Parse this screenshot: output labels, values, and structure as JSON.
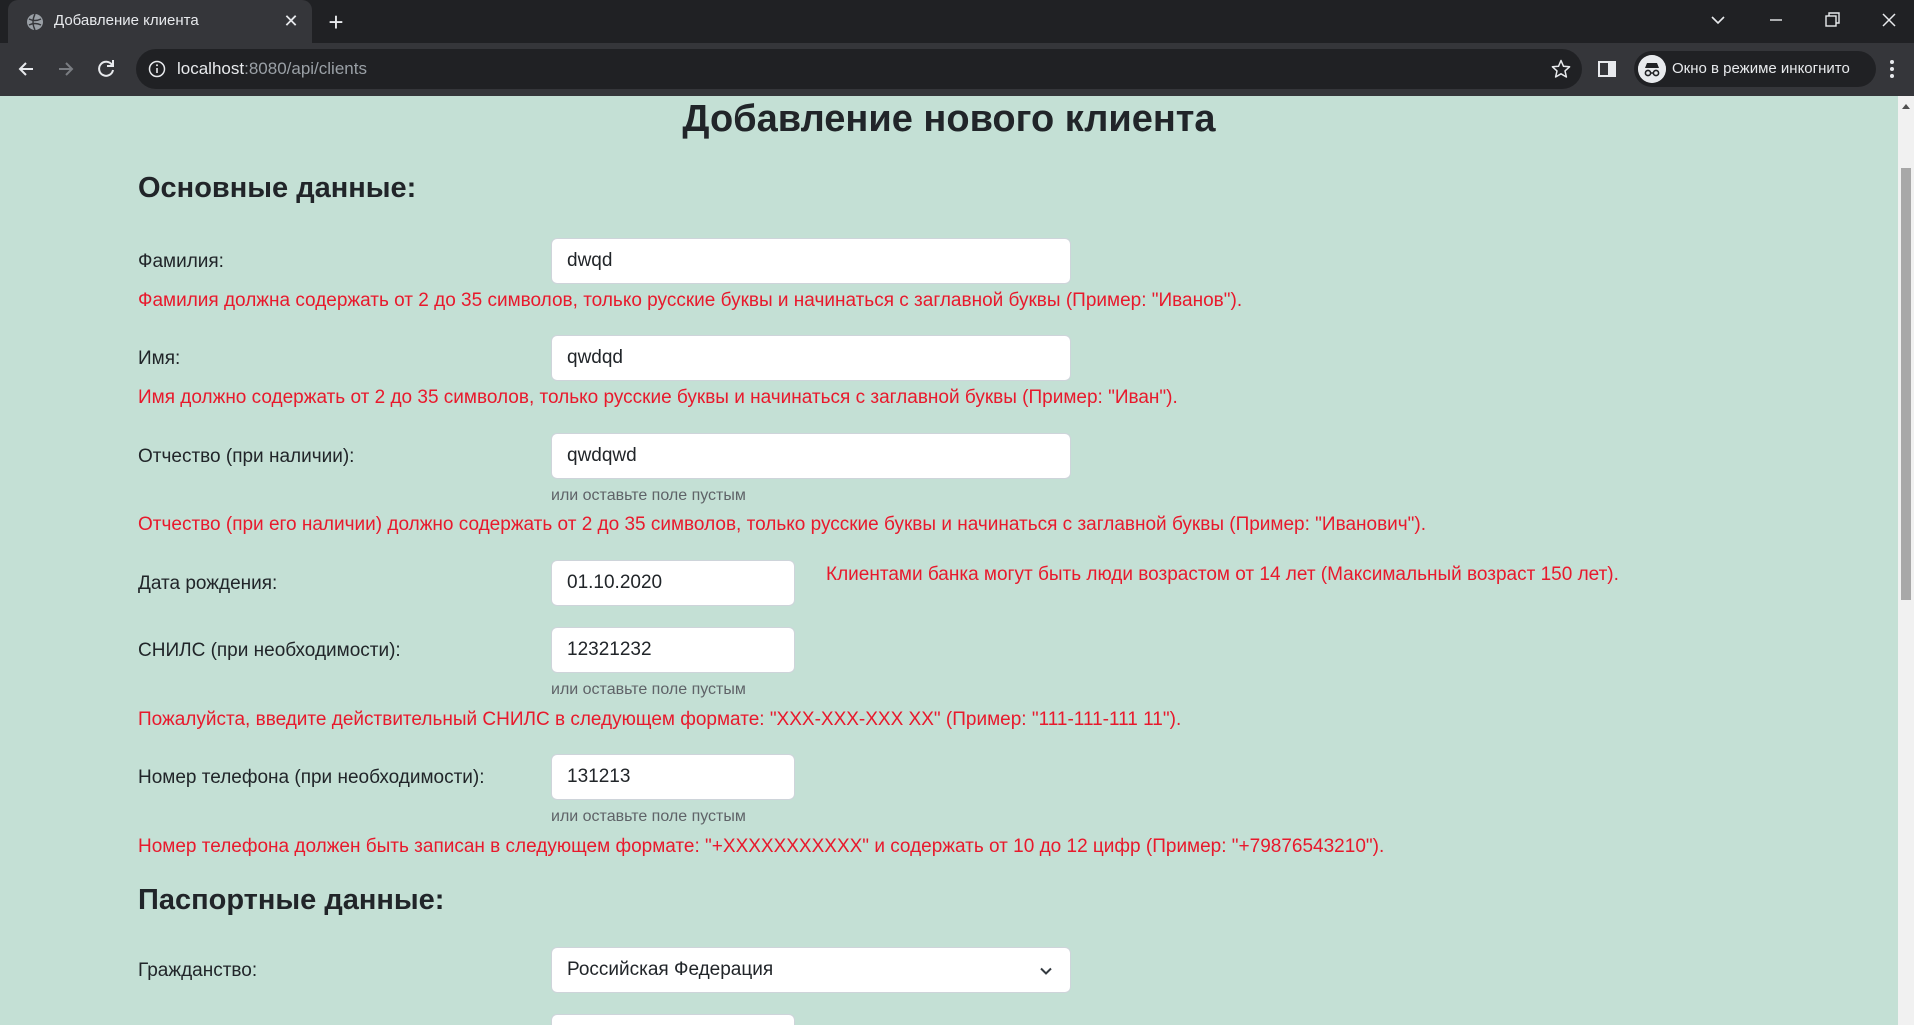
{
  "browser": {
    "tab_title": "Добавление клиента",
    "url_host": "localhost",
    "url_rest": ":8080/api/clients",
    "incognito_label": "Окно в режиме инкогнито"
  },
  "page": {
    "title": "Добавление нового клиента",
    "section_main": "Основные данные:",
    "section_passport": "Паспортные данные:"
  },
  "form": {
    "last_name": {
      "label": "Фамилия:",
      "value": "dwqd",
      "error": "Фамилия должна содержать от 2 до 35 символов, только русские буквы и начинаться с заглавной буквы (Пример: \"Иванов\")."
    },
    "first_name": {
      "label": "Имя:",
      "value": "qwdqd",
      "error": "Имя должно содержать от 2 до 35 символов, только русские буквы и начинаться с заглавной буквы (Пример: \"Иван\")."
    },
    "middle_name": {
      "label": "Отчество (при наличии):",
      "value": "qwdqwd",
      "hint": "или оставьте поле пустым",
      "error": "Отчество (при его наличии) должно содержать от 2 до 35 символов, только русские буквы и начинаться с заглавной буквы (Пример: \"Иванович\")."
    },
    "birth_date": {
      "label": "Дата рождения:",
      "value": "01.10.2020",
      "error": "Клиентами банка могут быть люди возрастом от 14 лет (Максимальный возраст 150 лет)."
    },
    "snils": {
      "label": "СНИЛС (при необходимости):",
      "value": "12321232",
      "hint": "или оставьте поле пустым",
      "error": "Пожалуйста, введите действительный СНИЛС в следующем формате: \"XXX-XXX-XXX XX\" (Пример: \"111-111-111 11\")."
    },
    "phone": {
      "label": "Номер телефона (при необходимости):",
      "value": "131213",
      "hint": "или оставьте поле пустым",
      "error": "Номер телефона должен быть записан в следующем формате: \"+XXXXXXXXXXX\" и содержать от 10 до 12 цифр (Пример: \"+79876543210\")."
    },
    "citizenship": {
      "label": "Гражданство:",
      "value": "Российская Федерация"
    }
  },
  "icons": {
    "favicon": "globe-icon",
    "back": "arrow-left-icon",
    "forward": "arrow-right-icon",
    "reload": "reload-icon",
    "info": "info-icon",
    "bookmark": "star-icon",
    "side_panel": "side-panel-icon",
    "incognito": "incognito-icon",
    "menu": "kebab-menu-icon",
    "select": "chevron-down-icon"
  },
  "colors": {
    "page_background": "#c4e0d5",
    "error_text": "#e8192c",
    "heading_text": "#212529"
  }
}
